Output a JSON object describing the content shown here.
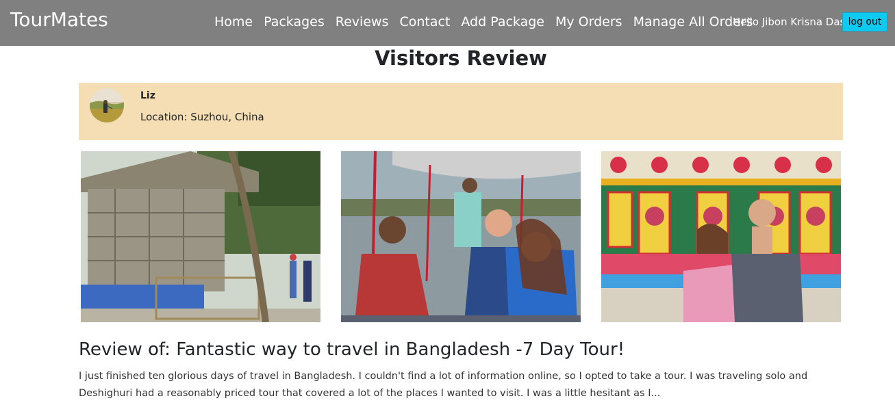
{
  "navbar": {
    "brand": "TourMates",
    "links": [
      "Home",
      "Packages",
      "Reviews",
      "Contact",
      "Add Package",
      "My Orders",
      "Manage All Orders"
    ],
    "greeting": "Hello Jibon Krisna Das",
    "logout_label": "log out",
    "background_color": "#808080",
    "logout_color": "#0dcaf0"
  },
  "page": {
    "title": "Visitors Review"
  },
  "reviewer": {
    "name": "Liz",
    "location": "Location: Suzhou, China",
    "card_color": "#f5deb3"
  },
  "review": {
    "title": "Review of: Fantastic way to travel in Bangladesh -7 Day Tour!",
    "body": "I just finished ten glorious days of travel in Bangladesh. I couldn't find a lot of information online, so I opted to take a tour. I was traveling solo and Deshighuri had a reasonably priced tour that covered a lot of the places I wanted to visit. I was a little hesitant as I..."
  }
}
